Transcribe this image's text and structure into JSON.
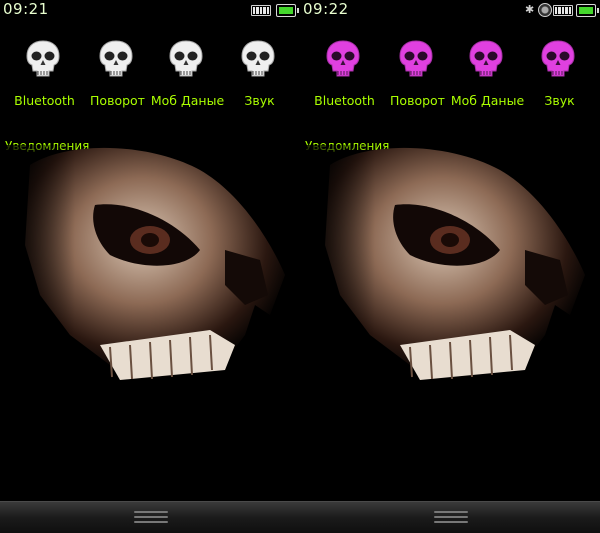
{
  "screens": [
    {
      "status": {
        "time": "09:21",
        "icons": [
          "signal-icon",
          "battery-icon"
        ]
      },
      "toggles": [
        {
          "label": "Bluetooth",
          "icon": "skull-icon"
        },
        {
          "label": "Поворот",
          "icon": "skull-icon"
        },
        {
          "label": "Моб Даные",
          "icon": "skull-icon"
        },
        {
          "label": "Звук",
          "icon": "skull-icon"
        }
      ],
      "toggle_color": "#f0f0f0",
      "notifications_header": "Уведомления"
    },
    {
      "status": {
        "time": "09:22",
        "icons": [
          "bluetooth-icon",
          "network-icon",
          "signal-icon",
          "battery-icon"
        ]
      },
      "toggles": [
        {
          "label": "Bluetooth",
          "icon": "skull-icon"
        },
        {
          "label": "Поворот",
          "icon": "skull-icon"
        },
        {
          "label": "Моб Даные",
          "icon": "skull-icon"
        },
        {
          "label": "Звук",
          "icon": "skull-icon"
        }
      ],
      "toggle_color": "#e040e0",
      "notifications_header": "Уведомления"
    }
  ],
  "colors": {
    "accent": "#aaff00",
    "battery": "#44d62c",
    "background": "#000000"
  }
}
